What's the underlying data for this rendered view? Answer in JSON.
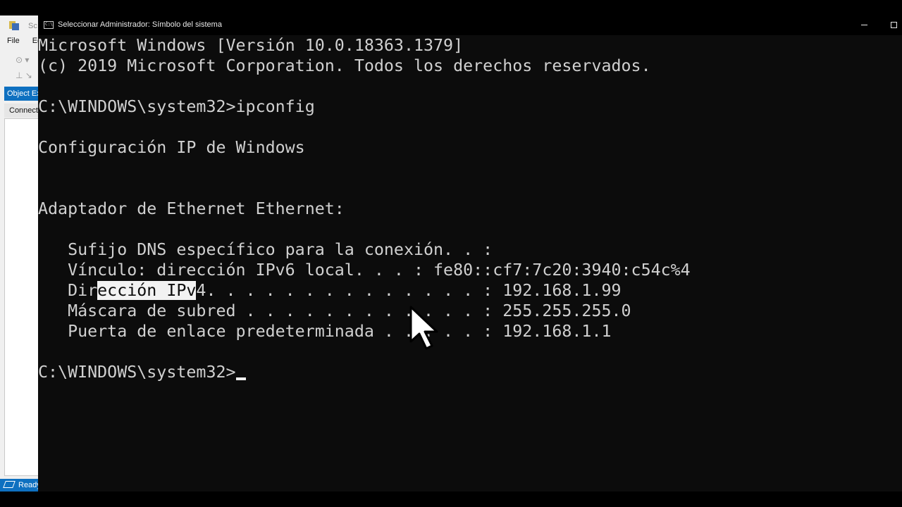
{
  "background_app": {
    "title_fragment": "Sc",
    "menu": [
      "File",
      "Ed"
    ],
    "object_explorer_tab": "Object Ex",
    "connect_label": "Connect",
    "status": "Ready",
    "accent_color": "#0e70c0"
  },
  "window": {
    "title": "Seleccionar Administrador: Símbolo del sistema",
    "icon": "cmd-icon",
    "controls": [
      "minimize-icon",
      "maximize-icon"
    ]
  },
  "terminal": {
    "lines": {
      "l1": "Microsoft Windows [Versión 10.0.18363.1379]",
      "l2": "(c) 2019 Microsoft Corporation. Todos los derechos reservados.",
      "l3": "C:\\WINDOWS\\system32>ipconfig",
      "l4": "Configuración IP de Windows",
      "l5": "Adaptador de Ethernet Ethernet:",
      "l6": "   Sufijo DNS específico para la conexión. . :",
      "l7": "   Vínculo: dirección IPv6 local. . . : fe80::cf7:7c20:3940:c54c%4",
      "l8_before": "   Dir",
      "l8_selected": "ección IPv",
      "l8_after": "4. . . . . . . . . . . . . . : 192.168.1.99",
      "l9": "   Máscara de subred . . . . . . . . . . . . : 255.255.255.0",
      "l10": "   Puerta de enlace predeterminada . . . . . : 192.168.1.1",
      "prompt": "C:\\WINDOWS\\system32>"
    },
    "colors": {
      "background": "#0c0c0c",
      "foreground": "#d0d0d0",
      "selection": "#f2f2f2"
    }
  }
}
